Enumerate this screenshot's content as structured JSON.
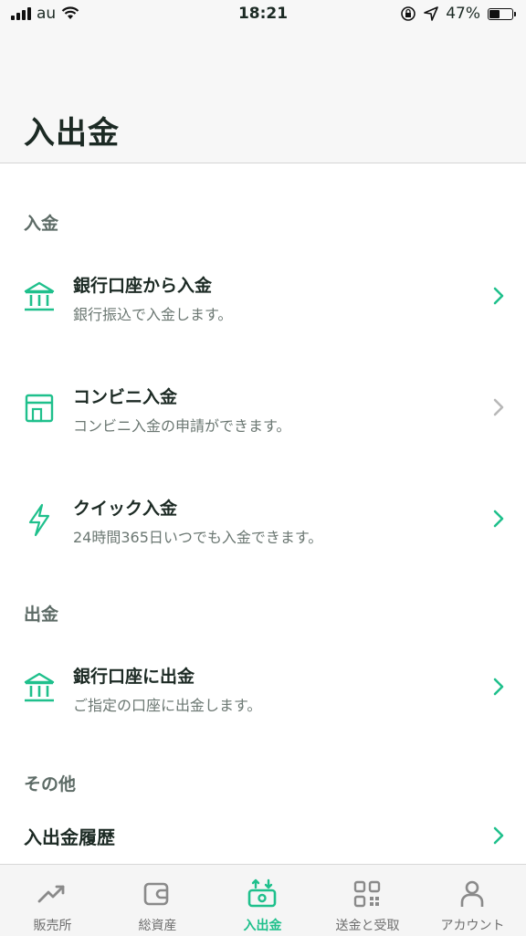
{
  "status_bar": {
    "carrier": "au",
    "time": "18:21",
    "battery": "47%",
    "battery_level": 0.47
  },
  "header": {
    "title": "入出金"
  },
  "sections": {
    "deposit": {
      "label": "入金",
      "items": [
        {
          "title": "銀行口座から入金",
          "subtitle": "銀行振込で入金します。",
          "icon": "bank-icon",
          "enabled": true
        },
        {
          "title": "コンビニ入金",
          "subtitle": "コンビニ入金の申請ができます。",
          "icon": "store-icon",
          "enabled": false
        },
        {
          "title": "クイック入金",
          "subtitle": "24時間365日いつでも入金できます。",
          "icon": "lightning-icon",
          "enabled": true
        }
      ]
    },
    "withdraw": {
      "label": "出金",
      "items": [
        {
          "title": "銀行口座に出金",
          "subtitle": "ご指定の口座に出金します。",
          "icon": "bank-icon",
          "enabled": true
        }
      ]
    },
    "other": {
      "label": "その他",
      "items": [
        {
          "title": "入出金履歴"
        }
      ]
    }
  },
  "tabbar": {
    "tabs": [
      {
        "label": "販売所",
        "icon": "chart-icon",
        "active": false
      },
      {
        "label": "総資産",
        "icon": "wallet-icon",
        "active": false
      },
      {
        "label": "入出金",
        "icon": "transfer-icon",
        "active": true
      },
      {
        "label": "送金と受取",
        "icon": "qr-icon",
        "active": false
      },
      {
        "label": "アカウント",
        "icon": "person-icon",
        "active": false
      }
    ]
  },
  "colors": {
    "accent": "#1fc08c",
    "text": "#1c2a24",
    "subtext": "#6b7772",
    "disabled_chevron": "#b8b8b8"
  }
}
